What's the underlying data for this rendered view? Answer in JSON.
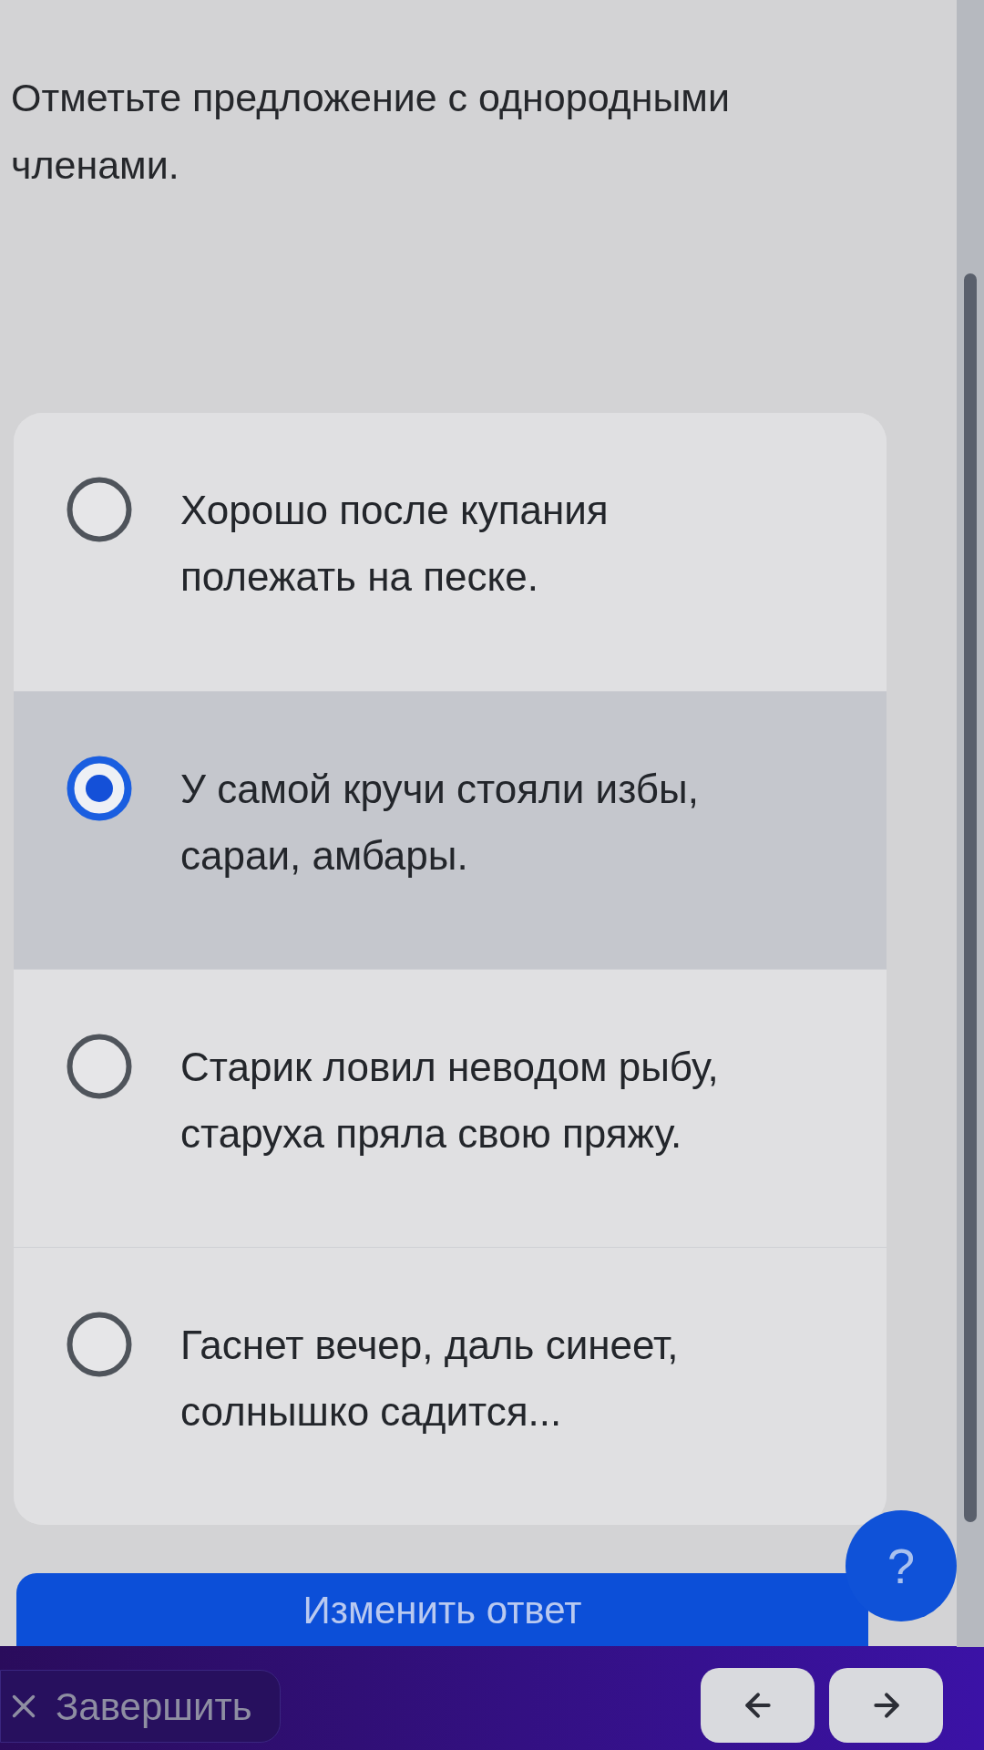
{
  "question": {
    "text": "Отметьте предложение с однородными членами."
  },
  "options": [
    {
      "text": "Хорошо после купания полежать на песке.",
      "selected": false
    },
    {
      "text": "У самой кручи стояли избы, сараи, амбары.",
      "selected": true
    },
    {
      "text": "Старик ловил неводом рыбу, старуха пряла свою пряжу.",
      "selected": false
    },
    {
      "text": "Гаснет вечер, даль синеет, солнышко садится...",
      "selected": false
    }
  ],
  "change_answer_button": {
    "label": "Изменить ответ"
  },
  "help_button": {
    "label": "?"
  },
  "bottom_bar": {
    "finish_button": {
      "label": "Завершить"
    }
  }
}
